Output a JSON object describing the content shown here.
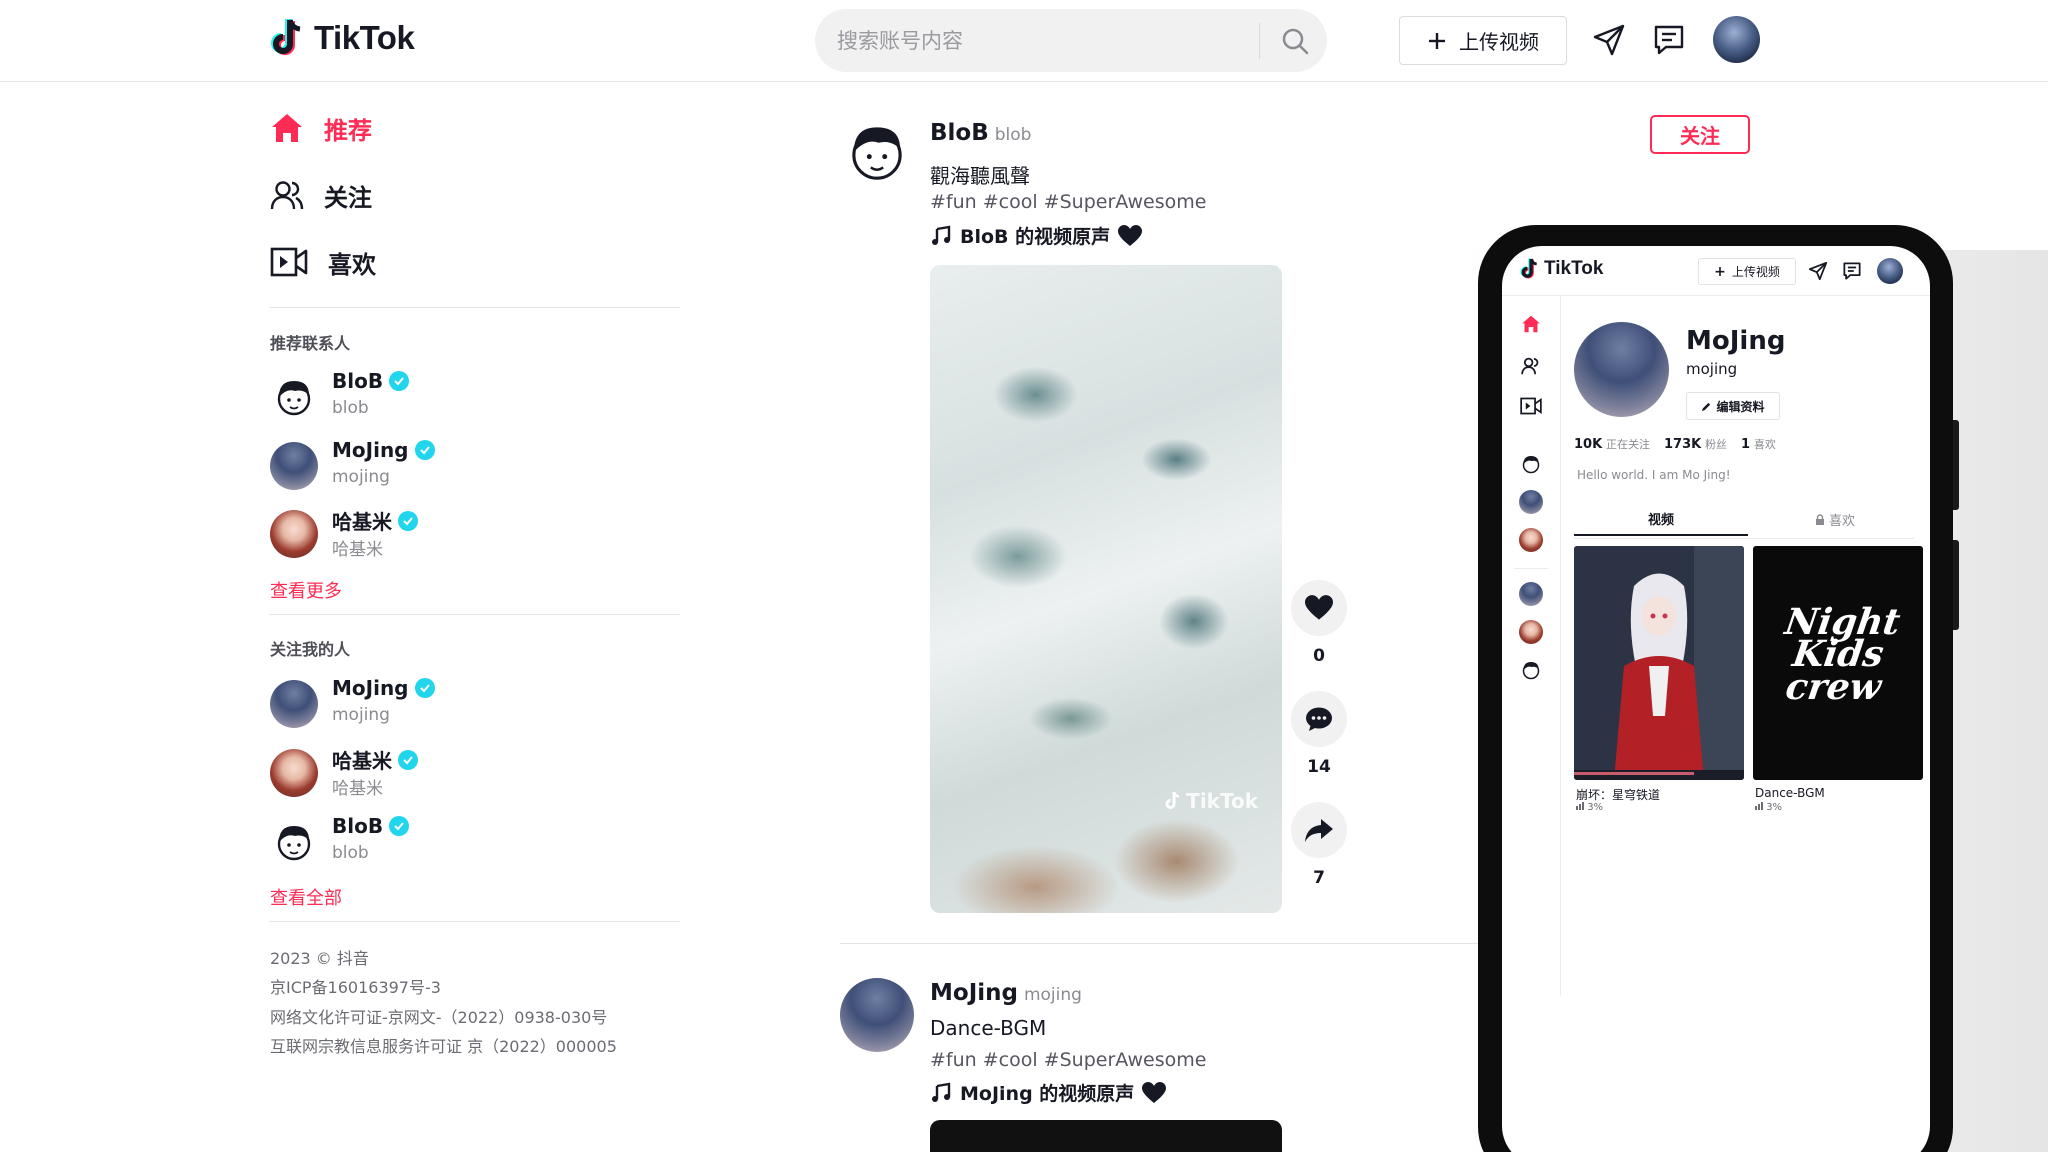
{
  "header": {
    "logo_text": "TikTok",
    "search_placeholder": "搜索账号内容",
    "upload_label": "上传视频"
  },
  "nav": [
    {
      "label": "推荐",
      "icon": "home-icon",
      "active": true
    },
    {
      "label": "关注",
      "icon": "users-icon",
      "active": false
    },
    {
      "label": "喜欢",
      "icon": "video-camera-icon",
      "active": false
    }
  ],
  "suggested": {
    "heading": "推荐联系人",
    "accounts": [
      {
        "name": "BloB",
        "username": "blob"
      },
      {
        "name": "MoJing",
        "username": "mojing"
      },
      {
        "name": "哈基米",
        "username": "哈基米"
      }
    ],
    "see_more": "查看更多"
  },
  "followers": {
    "heading": "关注我的人",
    "accounts": [
      {
        "name": "MoJing",
        "username": "mojing"
      },
      {
        "name": "哈基米",
        "username": "哈基米"
      },
      {
        "name": "BloB",
        "username": "blob"
      }
    ],
    "see_all": "查看全部"
  },
  "footer": [
    "2023 © 抖音",
    "京ICP备16016397号-3",
    "网络文化许可证-京网文-（2022）0938-030号",
    "互联网宗教信息服务许可证 京（2022）000005"
  ],
  "posts": [
    {
      "name": "BloB",
      "username": "blob",
      "desc": "觀海聽風聲",
      "tags": "#fun #cool #SuperAwesome",
      "music": "BloB 的视频原声",
      "follow_label": "关注",
      "watermark": "TikTok",
      "likes": "0",
      "comments": "14",
      "shares": "7"
    },
    {
      "name": "MoJing",
      "username": "mojing",
      "desc": "Dance-BGM",
      "tags": "#fun #cool #SuperAwesome",
      "music": "MoJing 的视频原声"
    }
  ],
  "phone": {
    "logo_text": "TikTok",
    "upload_label": "上传视频",
    "profile_name": "MoJing",
    "profile_username": "mojing",
    "edit_label": "编辑资料",
    "stats": [
      {
        "value": "10K",
        "label": "正在关注"
      },
      {
        "value": "173K",
        "label": "粉丝"
      },
      {
        "value": "1",
        "label": "喜欢"
      }
    ],
    "bio": "Hello world. I am Mo Jing!",
    "tab_videos": "视频",
    "tab_likes": "喜欢",
    "videos": [
      {
        "caption": "崩坏：星穹铁道",
        "meta": "3%"
      },
      {
        "caption": "Dance-BGM",
        "meta": "3%",
        "art_text": "Night Kids crew"
      }
    ]
  },
  "colors": {
    "accent": "#fe2c55",
    "verified": "#20d5ec",
    "text": "#161823"
  }
}
